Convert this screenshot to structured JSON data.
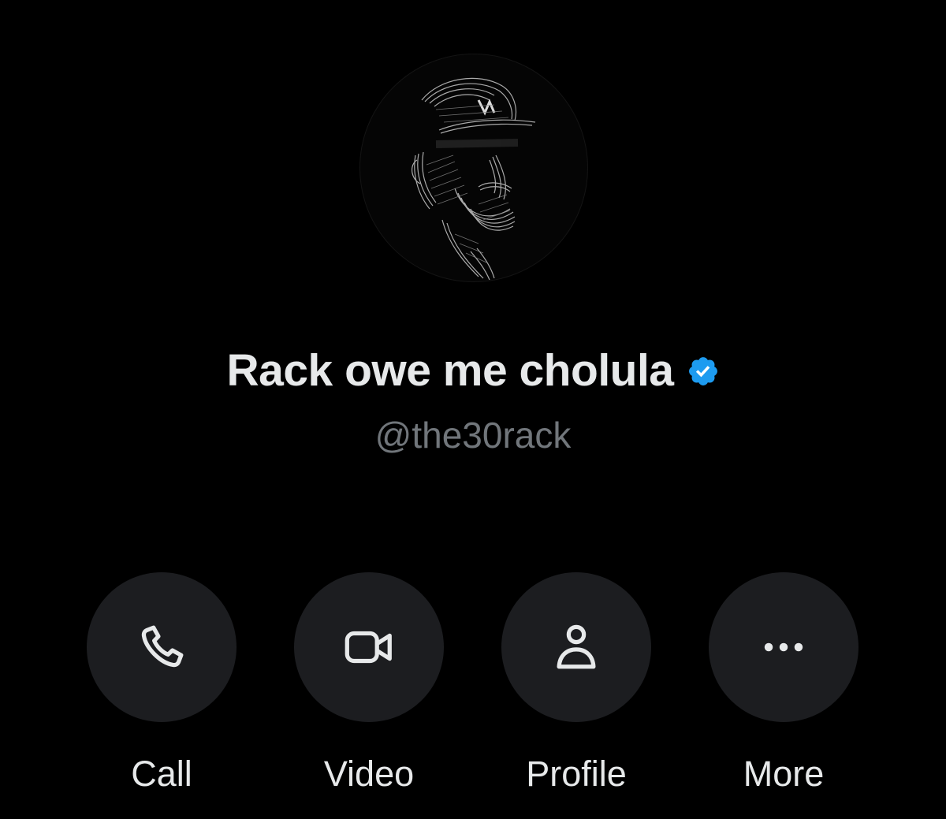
{
  "profile": {
    "display_name": "Rack owe me cholula",
    "handle": "@the30rack",
    "verified": true,
    "avatar_icon": "sketch-portrait-avatar"
  },
  "actions": [
    {
      "label": "Call",
      "icon": "phone-icon"
    },
    {
      "label": "Video",
      "icon": "video-camera-icon"
    },
    {
      "label": "Profile",
      "icon": "person-icon"
    },
    {
      "label": "More",
      "icon": "more-dots-icon"
    }
  ],
  "colors": {
    "background": "#000000",
    "text_primary": "#e7e9ea",
    "text_secondary": "#71767b",
    "button_bg": "#1c1d20",
    "verified_badge": "#1d9bf0"
  }
}
